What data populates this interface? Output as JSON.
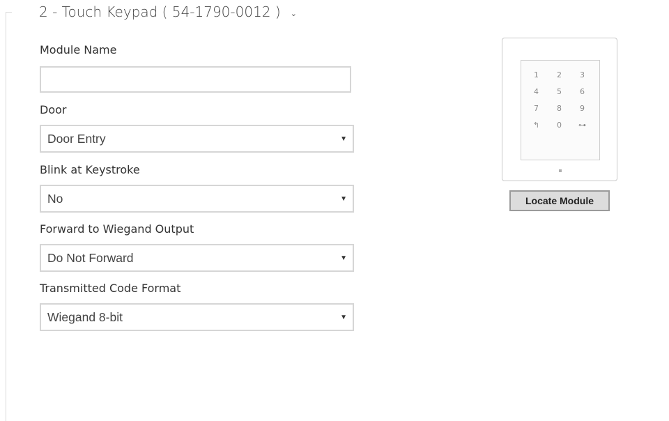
{
  "module": {
    "title": "2 - Touch Keypad ( 54-1790-0012 )",
    "chevron": "⌄"
  },
  "fields": {
    "module_name": {
      "label": "Module Name",
      "value": ""
    },
    "door": {
      "label": "Door",
      "value": "Door Entry"
    },
    "blink": {
      "label": "Blink at Keystroke",
      "value": "No"
    },
    "forward": {
      "label": "Forward to Wiegand Output",
      "value": "Do Not Forward"
    },
    "format": {
      "label": "Transmitted Code Format",
      "value": "Wiegand 8-bit"
    }
  },
  "keypad": {
    "keys": [
      "1",
      "2",
      "3",
      "4",
      "5",
      "6",
      "7",
      "8",
      "9",
      "↰",
      "0",
      "⊶"
    ]
  },
  "locate_button": "Locate Module"
}
